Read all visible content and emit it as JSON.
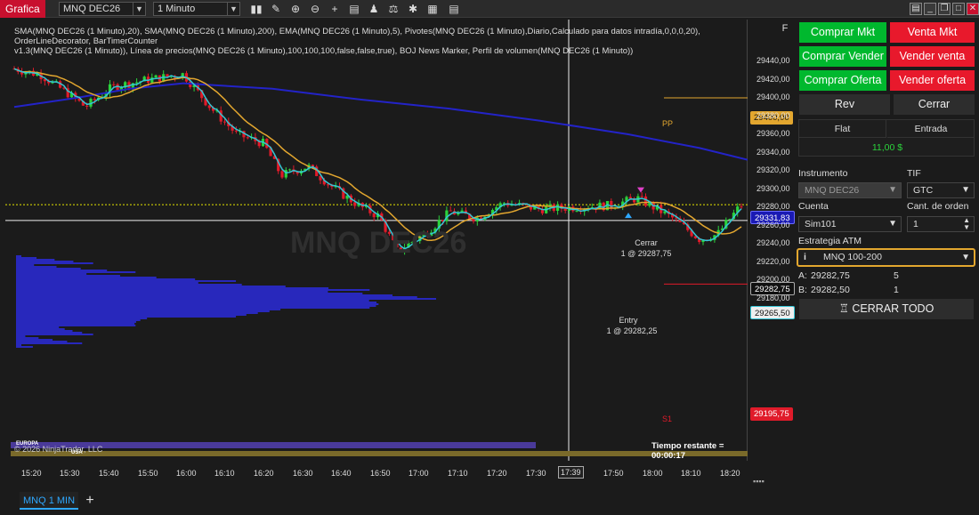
{
  "app": {
    "title": "Grafica"
  },
  "toolbar": {
    "instrument": "MNQ DEC26",
    "period": "1 Minuto",
    "icons": [
      "bar-chart-icon",
      "pencil-icon",
      "zoom-in-icon",
      "zoom-out-icon",
      "crosshair-icon",
      "properties-icon",
      "strategies-icon",
      "indicators-icon",
      "templates-icon",
      "data-box-icon"
    ]
  },
  "chart": {
    "indicators_line1": "SMA(MNQ DEC26 (1 Minuto),20), SMA(MNQ DEC26 (1 Minuto),200), EMA(MNQ DEC26 (1 Minuto),5), Pivotes(MNQ DEC26 (1 Minuto),Diario,Calculado para datos intradía,0,0,0,20), OrderLineDecorator, BarTimerCounter",
    "indicators_line2": "v1.3(MNQ DEC26 (1 Minuto)), Línea de precios(MNQ DEC26 (1 Minuto),100,100,100,false,false,true), BOJ News Marker, Perfil de volumen(MNQ DEC26 (1 Minuto))",
    "watermark": "MNQ DEC26",
    "f_button": "F",
    "y_ticks": [
      "29440,00",
      "29420,00",
      "29400,00",
      "29380,00",
      "29360,00",
      "29340,00",
      "29320,00",
      "29300,00",
      "29280,00",
      "29260,00",
      "29240,00",
      "29220,00",
      "29200,00",
      "29180,00"
    ],
    "y_tick_values": [
      29440,
      29420,
      29400,
      29380,
      29360,
      29340,
      29320,
      29300,
      29280,
      29260,
      29240,
      29220,
      29200,
      29180
    ],
    "x_ticks": [
      "15:20",
      "15:30",
      "15:40",
      "15:50",
      "16:00",
      "16:10",
      "16:20",
      "16:30",
      "16:40",
      "16:50",
      "17:00",
      "17:10",
      "17:20",
      "17:30",
      "17:39",
      "17:50",
      "18:00",
      "18:10",
      "18:20"
    ],
    "pp_label": "PP",
    "pp_value": "29400,00",
    "s1_label": "S1",
    "s1_value": "29195,75",
    "sma200_value": "29331,83",
    "last_price": "29282,75",
    "cursor_price": "29265,50",
    "exit_label": "Cerrar",
    "exit_detail": "1 @ 29287,75",
    "entry_label": "Entry",
    "entry_detail": "1 @ 29282,25",
    "copyright": "© 2026 NinjaTrader, LLC",
    "session_europe": "EUROPA",
    "session_usa": "USA",
    "remaining": "Tiempo restante = 00:00:17",
    "colors": {
      "up": "#2bd33c",
      "down": "#e01b2a",
      "sma20": "#e3a72f",
      "sma200": "#2323c8",
      "ema5": "#34c6d6"
    }
  },
  "tabs": {
    "main": "MNQ 1 MIN",
    "add": "+"
  },
  "panel": {
    "buy_mkt": "Comprar Mkt",
    "sell_mkt": "Venta Mkt",
    "buy_ask": "Comprar Vender",
    "sell_ask": "Vender venta",
    "buy_bid": "Comprar Oferta",
    "sell_bid": "Vender oferta",
    "rev": "Rev",
    "close": "Cerrar",
    "pos_flat": "Flat",
    "pos_entry": "Entrada",
    "pos_pnl": "11,00 $",
    "instrument_label": "Instrumento",
    "instrument_value": "MNQ DEC26",
    "tif_label": "TIF",
    "tif_value": "GTC",
    "account_label": "Cuenta",
    "account_value": "Sim101",
    "qty_label": "Cant. de orden",
    "qty_value": "1",
    "atm_label": "Estrategia ATM",
    "atm_value": "MNQ 100-200",
    "ask_label": "A:",
    "ask_price": "29282,75",
    "ask_size": "5",
    "bid_label": "B:",
    "bid_price": "29282,50",
    "bid_size": "1",
    "close_all": "CERRAR TODO"
  }
}
